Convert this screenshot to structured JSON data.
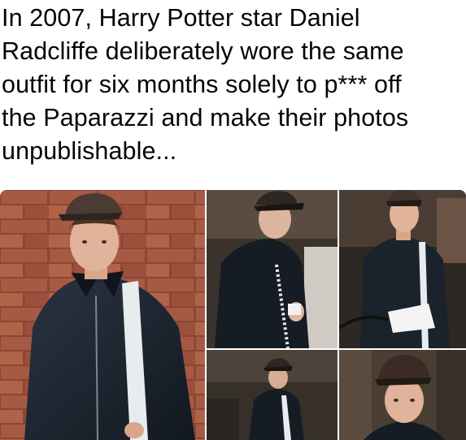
{
  "post": {
    "caption_lines": [
      "In 2007, Harry Potter star Daniel",
      "Radcliffe deliberately wore the same",
      "outfit for six months solely to p*** off",
      "the Paparazzi and make their photos",
      "unpublishable..."
    ]
  },
  "collage": {
    "photos": [
      {
        "subject": "man in cap and leather jacket against brick wall"
      },
      {
        "subject": "man in cap and leather jacket looking down"
      },
      {
        "subject": "man in cap and leather jacket holding papers"
      },
      {
        "subject": "man in cap walking"
      },
      {
        "subject": "man in cap close-up"
      }
    ]
  },
  "colors": {
    "text": "#050505",
    "background": "#ffffff",
    "brick": "#a3543f",
    "jacket": "#1b2430",
    "stripe": "#e9ecef"
  }
}
